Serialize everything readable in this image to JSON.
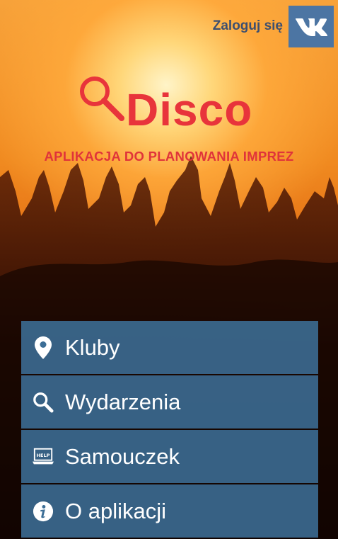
{
  "header": {
    "login_label": "Zaloguj się",
    "vk_icon": "vk-logo-icon"
  },
  "logo": {
    "title": "Disco",
    "icon": "search-icon"
  },
  "tagline": "APLIKACJA DO PLANOWANIA IMPREZ",
  "menu": {
    "items": [
      {
        "label": "Kluby",
        "icon": "location-pin-icon"
      },
      {
        "label": "Wydarzenia",
        "icon": "search-icon"
      },
      {
        "label": "Samouczek",
        "icon": "help-laptop-icon"
      },
      {
        "label": "O aplikacji",
        "icon": "info-icon"
      }
    ]
  },
  "colors": {
    "accent_red": "#e8343b",
    "vk_blue": "#4c75a3",
    "menu_blue": "#3c6e96",
    "login_text": "#3d4f6f"
  }
}
